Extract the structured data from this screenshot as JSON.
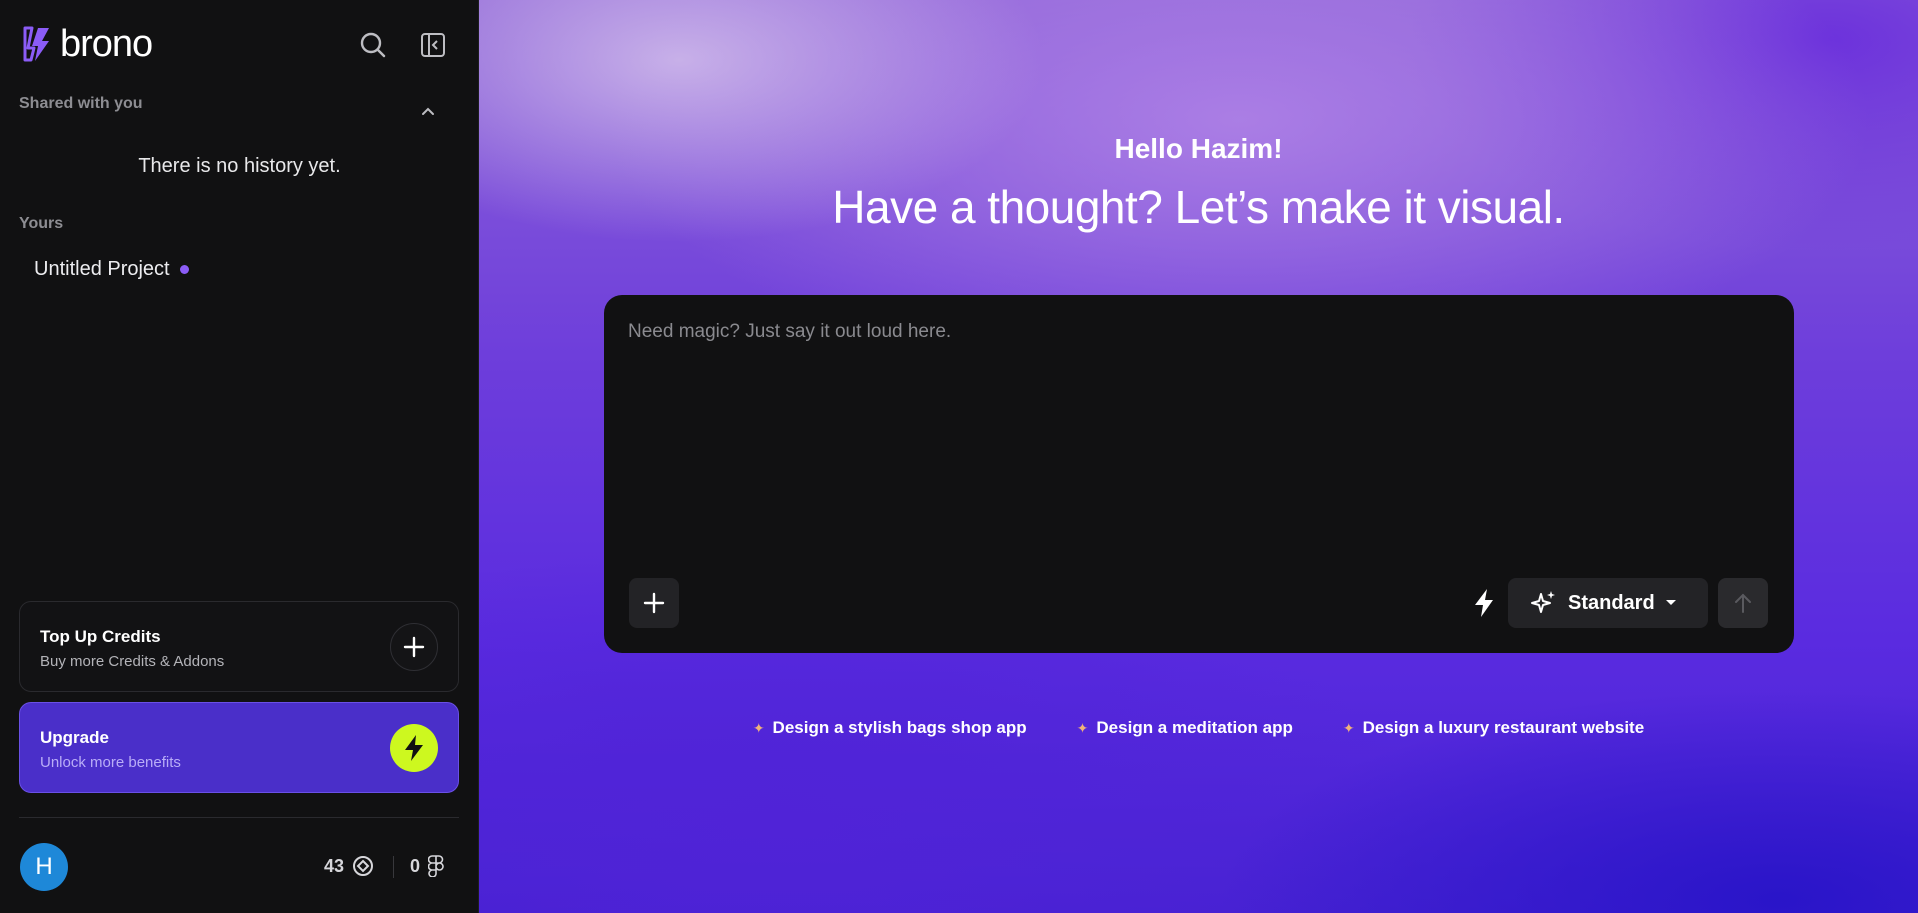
{
  "brand": {
    "name": "brono"
  },
  "sidebar": {
    "shared_label": "Shared with you",
    "empty_history": "There is no history yet.",
    "yours_label": "Yours",
    "projects": [
      {
        "label": "Untitled Project"
      }
    ],
    "topup": {
      "title": "Top Up Credits",
      "subtitle": "Buy more Credits & Addons"
    },
    "upgrade": {
      "title": "Upgrade",
      "subtitle": "Unlock more benefits"
    },
    "user": {
      "initial": "H"
    },
    "credits": "43",
    "figma_count": "0"
  },
  "main": {
    "greeting": "Hello Hazim!",
    "headline": "Have a thought? Let’s make it visual.",
    "composer": {
      "placeholder": "Need magic? Just say it out loud here.",
      "value": "",
      "model": "Standard"
    },
    "suggestions": [
      "Design a stylish bags shop app",
      "Design a meditation app",
      "Design a luxury restaurant website"
    ]
  },
  "colors": {
    "accent": "#8b5cf6",
    "upgrade_bg": "#4a2fc9",
    "lime": "#cdf81f",
    "avatar": "#1e88d8",
    "suggestion_spark": "#f0b27a"
  },
  "icons": {
    "search": "search-icon",
    "collapse": "sidebar-collapse-icon",
    "chevron": "chevron-up-icon",
    "plus": "plus-icon",
    "bolt": "bolt-icon",
    "sparkle": "sparkle-icon",
    "caret": "caret-down-icon",
    "send": "arrow-up-icon",
    "credit": "credit-icon",
    "figma": "figma-icon"
  }
}
